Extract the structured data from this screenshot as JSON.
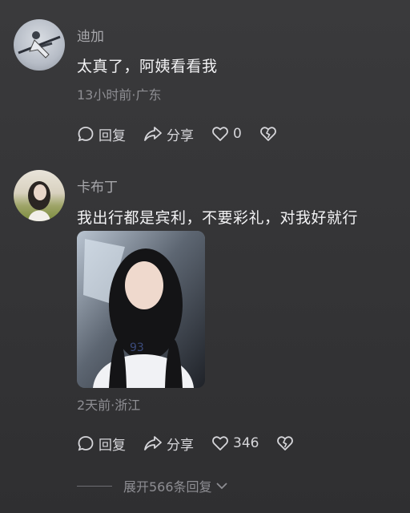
{
  "comments": [
    {
      "username": "迪加",
      "text": "太真了，阿姨看看我",
      "meta": "13小时前·广东",
      "actions": {
        "reply": "回复",
        "share": "分享",
        "likes": "0"
      }
    },
    {
      "username": "卡布丁",
      "text": "我出行都是宾利，不要彩礼，对我好就行",
      "meta": "2天前·浙江",
      "actions": {
        "reply": "回复",
        "share": "分享",
        "likes": "346"
      },
      "photo": true
    }
  ],
  "expand_label": "展开566条回复",
  "icons": [
    "reply-bubble-icon",
    "share-arrow-icon",
    "heart-icon",
    "broken-heart-icon",
    "chevron-down-icon"
  ],
  "colors": {
    "background": "#353537",
    "text": "#f2f2f4",
    "secondary": "#8e8e93"
  }
}
